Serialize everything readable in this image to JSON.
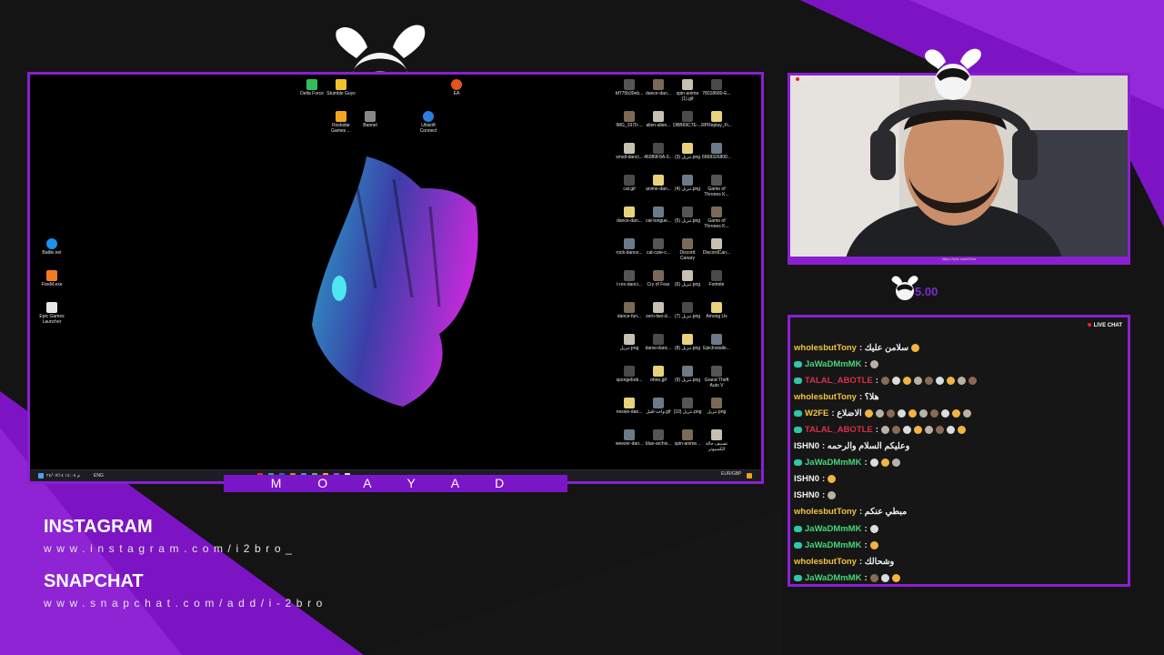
{
  "screen": {
    "name_label": "M O A Y A D",
    "desktop_left_icons": [
      "Battle.net",
      "FiveM.exe",
      "Epic Games Launcher"
    ],
    "desktop_top_icons": [
      "Delta Force",
      "Stumble Guys",
      "Rockstar Games ...",
      "Bannel",
      "Ubisoft Connect",
      "EA"
    ],
    "desktop_right_icons": [
      [
        "bf775b30eb...",
        "dance-dan...",
        "spin-anime (1).gif",
        "78018680-E..."
      ],
      [
        "IMG_1970-...",
        "alien-alien...",
        "DBB69C7E-...",
        "RPReplay_Fi..."
      ],
      [
        "small-danci...",
        "46089F8A-0...",
        "تنزيل (3).png",
        "6668326800..."
      ],
      [
        "cat.gif",
        "anime-dan...",
        "تنزيل (4).png",
        "Game of Thrones K..."
      ],
      [
        "dance-dan...",
        "cat-tongue...",
        "تنزيل (5).png",
        "Game of Thrones K..."
      ],
      [
        "rock-dance...",
        "cat-cute-c...",
        "Discord Canary",
        "DiscordCan..."
      ],
      [
        "t-rex-danci...",
        "Cry of Fear",
        "تنزيل (6).png",
        "Fortnite"
      ],
      [
        "dance-fun...",
        "zero-two-d...",
        "تنزيل (7).png",
        "Among Us"
      ],
      [
        "تنزيل.png",
        "dansi-danc...",
        "تنزيل (8).png",
        "EpicInstalle..."
      ],
      [
        "spongebob...",
        "ohno.gif",
        "تنزيل (9).png",
        "Grand Theft Auto V"
      ],
      [
        "nessie-dan...",
        "واحد-اقبل.gif",
        "تنزيل (10).png",
        "تنزيل.png"
      ],
      [
        "weezer-dan...",
        "blue-archiv...",
        "spin-anime...",
        "تصنيف حالة الكمبيوتر"
      ]
    ],
    "taskbar_left": "ﻡ ١٤:٠٨ ٢٤/٠٧/١٤",
    "taskbar_lang": "ENG",
    "taskbar_right": "EUR/GBP"
  },
  "cam": {
    "live_label": "LIVE",
    "url": "https://kick.com/i2bro"
  },
  "sub_count": "5.00",
  "chat": {
    "header": "LIVE CHAT",
    "messages": [
      {
        "user": "wholesbutTony",
        "color": "#f0c43c",
        "text": ": سلامن عليك",
        "badge": false,
        "emotes": 1
      },
      {
        "user": "JaWaDMmMK",
        "color": "#46d678",
        "text": ":",
        "badge": true,
        "emotes": 1
      },
      {
        "user": "TALAL_ABOTLE",
        "color": "#d9304a",
        "text": ":",
        "badge": true,
        "emotes": 9
      },
      {
        "user": "wholesbutTony",
        "color": "#f0c43c",
        "text": ": هلا؟",
        "badge": false,
        "emotes": 0
      },
      {
        "user": "W2FE",
        "color": "#f0c43c",
        "text": ": الاضلاع",
        "badge": true,
        "emotes": 10
      },
      {
        "user": "TALAL_ABOTLE",
        "color": "#d9304a",
        "text": ":",
        "badge": true,
        "emotes": 8
      },
      {
        "user": "ISHN0",
        "color": "#f2f2f2",
        "text": ": وعليكم السلام والرحمه",
        "badge": false,
        "emotes": 0
      },
      {
        "user": "JaWaDMmMK",
        "color": "#46d678",
        "text": ":",
        "badge": true,
        "emotes": 3
      },
      {
        "user": "ISHN0",
        "color": "#f2f2f2",
        "text": ":",
        "badge": false,
        "emotes": 1
      },
      {
        "user": "ISHN0",
        "color": "#f2f2f2",
        "text": ":",
        "badge": false,
        "emotes": 1
      },
      {
        "user": "wholesbutTony",
        "color": "#f0c43c",
        "text": ": مبطي عنكم",
        "badge": false,
        "emotes": 0
      },
      {
        "user": "JaWaDMmMK",
        "color": "#46d678",
        "text": ":",
        "badge": true,
        "emotes": 1
      },
      {
        "user": "JaWaDMmMK",
        "color": "#46d678",
        "text": ":",
        "badge": true,
        "emotes": 1
      },
      {
        "user": "wholesbutTony",
        "color": "#f0c43c",
        "text": ": وشحالك",
        "badge": false,
        "emotes": 0
      },
      {
        "user": "JaWaDMmMK",
        "color": "#46d678",
        "text": ":",
        "badge": true,
        "emotes": 3
      }
    ]
  },
  "socials": {
    "instagram_title": "INSTAGRAM",
    "instagram_url": "www.instagram.com/i2bro_",
    "snapchat_title": "SNAPCHAT",
    "snapchat_url": "www.snapchat.com/add/i-2bro"
  },
  "colors": {
    "accent": "#8a1fd1",
    "background": "#141414"
  },
  "icons": [
    "bunny-mascot-icon",
    "folder-icon",
    "app-icon",
    "windows-start-icon"
  ]
}
